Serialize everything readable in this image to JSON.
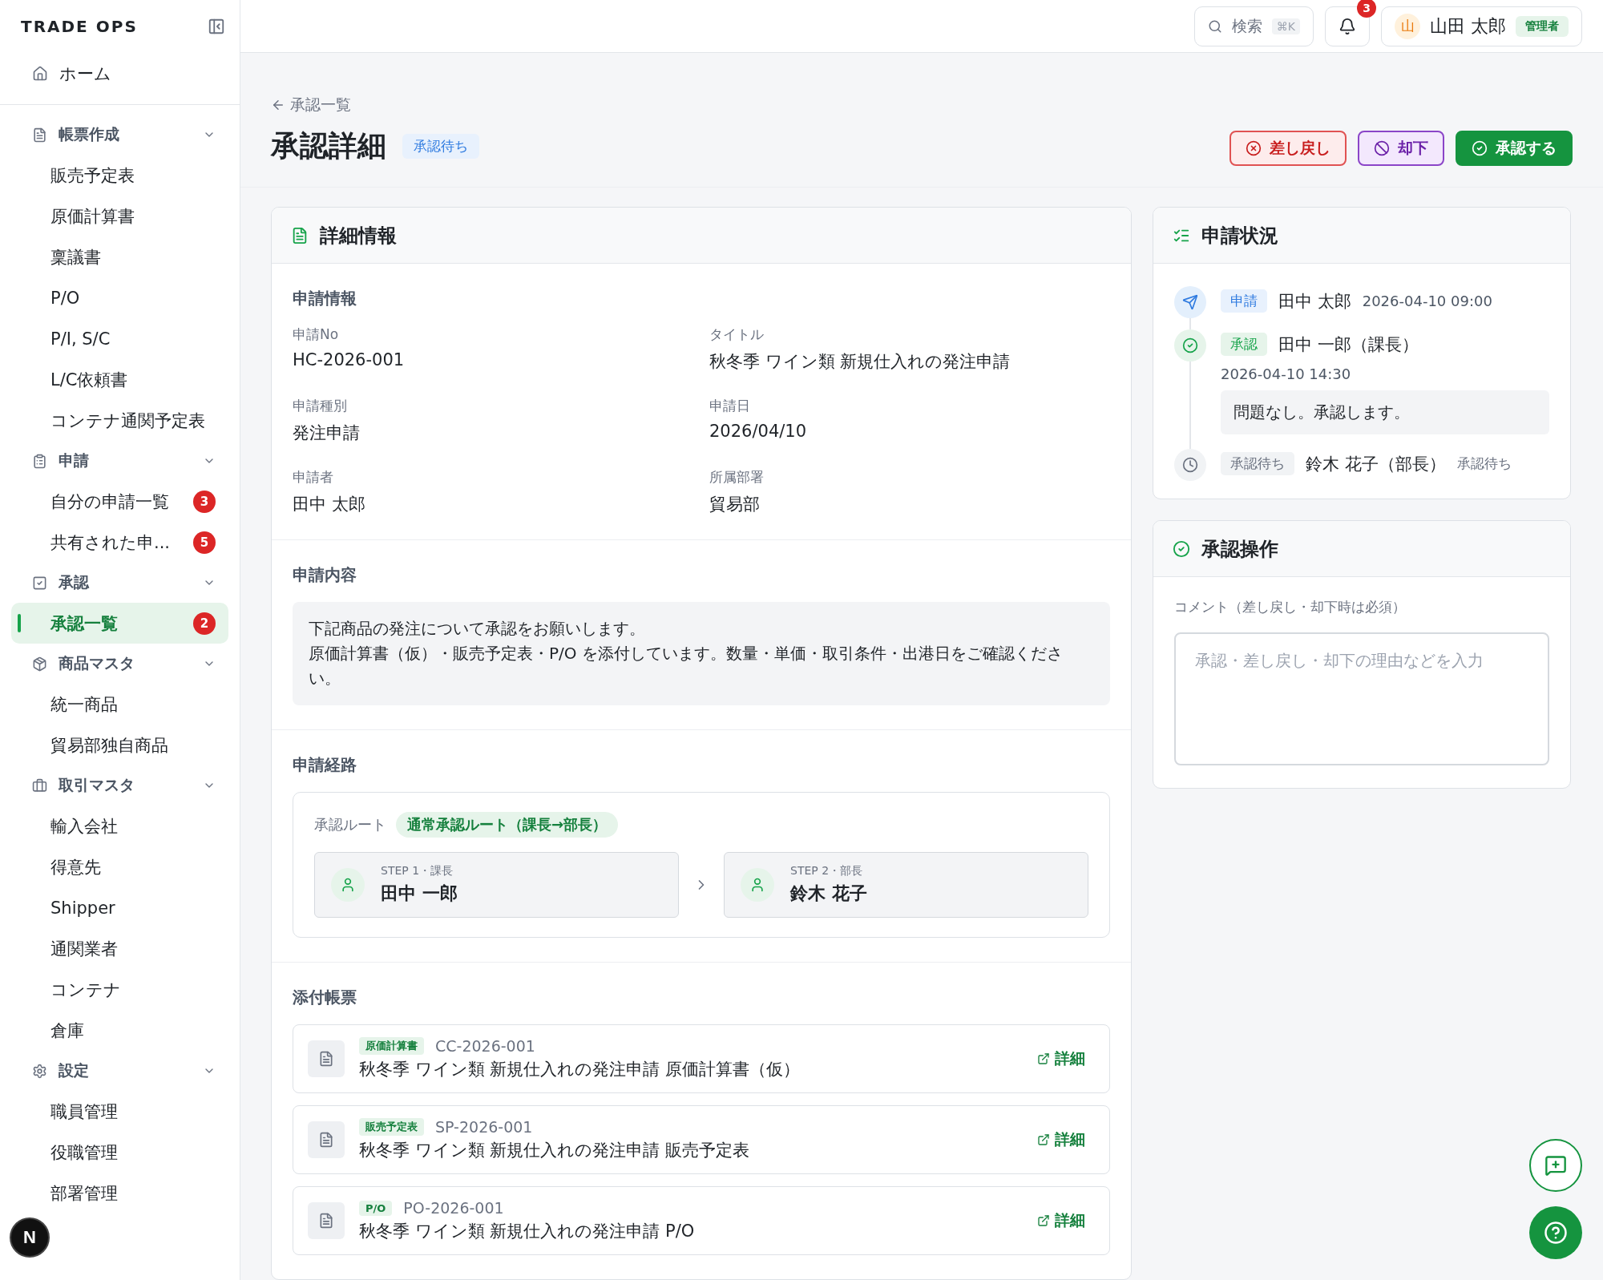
{
  "sidebar": {
    "brand": "TRADE OPS",
    "home": {
      "label": "ホーム",
      "selected": false
    },
    "groups": [
      {
        "label": "帳票作成",
        "expanded": true,
        "items": [
          {
            "label": "販売予定表",
            "selected": false
          },
          {
            "label": "原価計算書",
            "selected": false
          },
          {
            "label": "稟議書",
            "selected": false
          },
          {
            "label": "P/O",
            "selected": false
          },
          {
            "label": "P/I, S/C",
            "selected": false
          },
          {
            "label": "L/C依頼書",
            "selected": false
          },
          {
            "label": "コンテナ通関予定表",
            "selected": false
          }
        ]
      },
      {
        "label": "申請",
        "expanded": true,
        "items": [
          {
            "label": "自分の申請一覧",
            "selected": false,
            "badge": "3"
          },
          {
            "label": "共有された申...",
            "selected": false,
            "badge": "5"
          }
        ]
      },
      {
        "label": "承認",
        "expanded": true,
        "items": [
          {
            "label": "承認一覧",
            "selected": true,
            "badge": "2"
          }
        ]
      },
      {
        "label": "商品マスタ",
        "expanded": true,
        "items": [
          {
            "label": "統一商品",
            "selected": false
          },
          {
            "label": "貿易部独自商品",
            "selected": false
          }
        ]
      },
      {
        "label": "取引マスタ",
        "expanded": true,
        "items": [
          {
            "label": "輸入会社",
            "selected": false
          },
          {
            "label": "得意先",
            "selected": false
          },
          {
            "label": "Shipper",
            "selected": false
          },
          {
            "label": "通関業者",
            "selected": false
          },
          {
            "label": "コンテナ",
            "selected": false
          },
          {
            "label": "倉庫",
            "selected": false
          }
        ]
      },
      {
        "label": "設定",
        "expanded": true,
        "items": [
          {
            "label": "職員管理",
            "selected": false
          },
          {
            "label": "役職管理",
            "selected": false
          },
          {
            "label": "部署管理",
            "selected": false
          }
        ]
      }
    ],
    "dev_badge": "N"
  },
  "header": {
    "search": {
      "label": "検索",
      "shortcut": "⌘K"
    },
    "notifications": {
      "count": "3"
    },
    "user": {
      "initial": "山",
      "name": "山田 太郎",
      "role": "管理者"
    }
  },
  "page": {
    "back": "承認一覧",
    "title": "承認詳細",
    "status": "承認待ち",
    "actions": [
      {
        "kind": "return",
        "label": "差し戻し"
      },
      {
        "kind": "reject",
        "label": "却下"
      },
      {
        "kind": "approve",
        "label": "承認する"
      }
    ]
  },
  "details": {
    "title": "詳細情報",
    "info_heading": "申請情報",
    "fields": [
      {
        "label": "申請No",
        "value": "HC-2026-001"
      },
      {
        "label": "タイトル",
        "value": "秋冬季 ワイン類 新規仕入れの発注申請"
      },
      {
        "label": "申請種別",
        "value": "発注申請"
      },
      {
        "label": "申請日",
        "value": "2026/04/10"
      },
      {
        "label": "申請者",
        "value": "田中 太郎"
      },
      {
        "label": "所属部署",
        "value": "貿易部"
      }
    ],
    "content_heading": "申請内容",
    "content": [
      "下記商品の発注について承認をお願いします。",
      "原価計算書（仮）・販売予定表・P/O を添付しています。数量・単価・取引条件・出港日をご確認ください。"
    ],
    "route_heading": "申請経路",
    "route_label": "承認ルート",
    "route_name": "通常承認ルート（課長→部長）",
    "steps": [
      {
        "step": "STEP 1・課長",
        "name": "田中 一郎"
      },
      {
        "step": "STEP 2・部長",
        "name": "鈴木 花子"
      }
    ],
    "attachments_heading": "添付帳票",
    "attachments": [
      {
        "tag": "原価計算書",
        "code": "CC-2026-001",
        "title": "秋冬季 ワイン類 新規仕入れの発注申請 原価計算書（仮）",
        "link": "詳細"
      },
      {
        "tag": "販売予定表",
        "code": "SP-2026-001",
        "title": "秋冬季 ワイン類 新規仕入れの発注申請 販売予定表",
        "link": "詳細"
      },
      {
        "tag": "P/O",
        "code": "PO-2026-001",
        "title": "秋冬季 ワイン類 新規仕入れの発注申請 P/O",
        "link": "詳細"
      }
    ]
  },
  "status": {
    "title": "申請状況",
    "events": [
      {
        "kind": "submitted",
        "tag": "申請",
        "name": "田中 太郎",
        "time": "2026-04-10 09:00"
      },
      {
        "kind": "approved",
        "tag": "承認",
        "name": "田中 一郎（課長）",
        "time": "2026-04-10 14:30",
        "comment": "問題なし。承認します。"
      },
      {
        "kind": "pending",
        "tag": "承認待ち",
        "name": "鈴木 花子（部長）",
        "note": "承認待ち"
      }
    ]
  },
  "operation": {
    "title": "承認操作",
    "label": "コメント（差し戻し・却下時は必須）",
    "placeholder": "承認・差し戻し・却下の理由などを入力"
  }
}
